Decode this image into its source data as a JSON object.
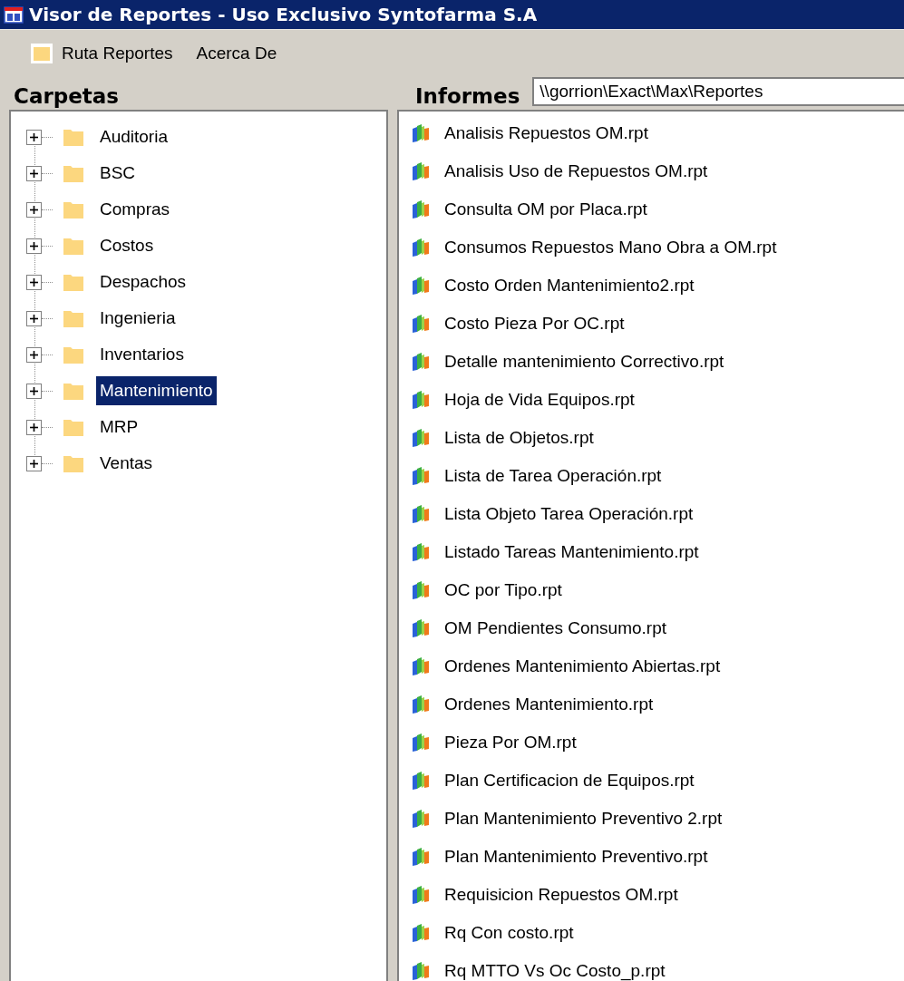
{
  "window": {
    "title": "Visor de Reportes - Uso Exclusivo Syntofarma S.A"
  },
  "menu": [
    {
      "label": "Ruta Reportes",
      "kind": "folder"
    },
    {
      "label": "Acerca De",
      "kind": "plain"
    }
  ],
  "folders_panel": {
    "title": "Carpetas",
    "items": [
      {
        "label": "Auditoria",
        "expanded": false,
        "selected": false
      },
      {
        "label": "BSC",
        "expanded": false,
        "selected": false
      },
      {
        "label": "Compras",
        "expanded": false,
        "selected": false
      },
      {
        "label": "Costos",
        "expanded": false,
        "selected": false
      },
      {
        "label": "Despachos",
        "expanded": false,
        "selected": false
      },
      {
        "label": "Ingenieria",
        "expanded": false,
        "selected": false
      },
      {
        "label": "Inventarios",
        "expanded": false,
        "selected": false
      },
      {
        "label": "Mantenimiento",
        "expanded": false,
        "selected": true
      },
      {
        "label": "MRP",
        "expanded": false,
        "selected": false
      },
      {
        "label": "Ventas",
        "expanded": false,
        "selected": false
      }
    ]
  },
  "reports_panel": {
    "title": "Informes",
    "path": "\\\\gorrion\\Exact\\Max\\Reportes",
    "items": [
      {
        "label": "Analisis Repuestos OM.rpt",
        "selected": false
      },
      {
        "label": "Analisis Uso de Repuestos OM.rpt",
        "selected": false
      },
      {
        "label": "Consulta OM por Placa.rpt",
        "selected": false
      },
      {
        "label": "Consumos Repuestos Mano Obra a OM.rpt",
        "selected": false
      },
      {
        "label": "Costo Orden Mantenimiento2.rpt",
        "selected": false
      },
      {
        "label": "Costo Pieza Por OC.rpt",
        "selected": false
      },
      {
        "label": "Detalle mantenimiento Correctivo.rpt",
        "selected": false
      },
      {
        "label": "Hoja de Vida Equipos.rpt",
        "selected": false
      },
      {
        "label": "Lista de Objetos.rpt",
        "selected": false
      },
      {
        "label": "Lista de Tarea Operación.rpt",
        "selected": false
      },
      {
        "label": "Lista Objeto Tarea Operación.rpt",
        "selected": false
      },
      {
        "label": "Listado Tareas Mantenimiento.rpt",
        "selected": false
      },
      {
        "label": "OC por Tipo.rpt",
        "selected": false
      },
      {
        "label": "OM Pendientes Consumo.rpt",
        "selected": false
      },
      {
        "label": "Ordenes Mantenimiento Abiertas.rpt",
        "selected": false
      },
      {
        "label": "Ordenes Mantenimiento.rpt",
        "selected": false
      },
      {
        "label": "Pieza Por OM.rpt",
        "selected": false
      },
      {
        "label": "Plan Certificacion de Equipos.rpt",
        "selected": false
      },
      {
        "label": "Plan Mantenimiento Preventivo 2.rpt",
        "selected": false
      },
      {
        "label": "Plan Mantenimiento Preventivo.rpt",
        "selected": false
      },
      {
        "label": "Requisicion Repuestos OM.rpt",
        "selected": false
      },
      {
        "label": "Rq Con costo.rpt",
        "selected": false
      },
      {
        "label": "Rq MTTO Vs Oc Costo_p.rpt",
        "selected": false
      }
    ]
  }
}
